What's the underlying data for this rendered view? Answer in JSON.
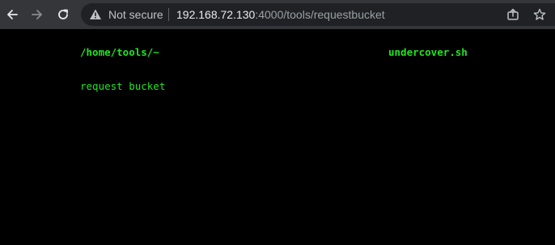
{
  "browser": {
    "security_label": "Not secure",
    "url_host": "192.168.72.130",
    "url_rest": ":4000/tools/requestbucket",
    "icons": {
      "back": "arrow-left-icon",
      "forward": "arrow-right-icon",
      "reload": "reload-icon",
      "warning": "warning-triangle-icon",
      "share": "share-icon",
      "bookmark": "star-icon"
    }
  },
  "page": {
    "path": "/home/tools/~",
    "script_name": "undercover.sh",
    "link": "request bucket"
  },
  "colors": {
    "background": "#000000",
    "terminal_green": "#21e321",
    "toolbar": "#35363a",
    "omnibox": "#202124"
  }
}
